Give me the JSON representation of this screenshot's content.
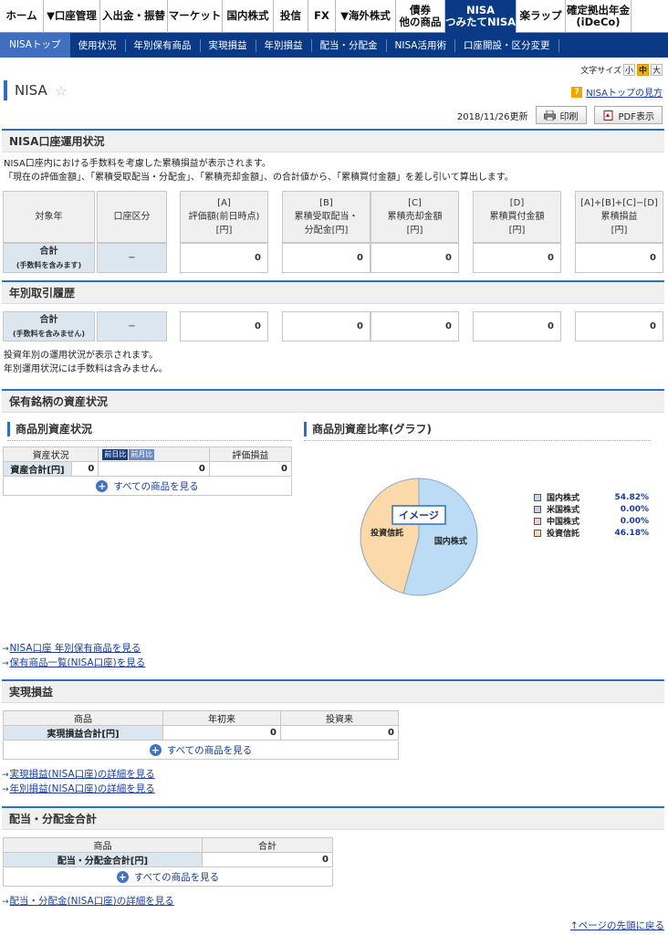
{
  "top_nav": [
    {
      "label": "ホーム",
      "name": "home",
      "w": 48
    },
    {
      "label": "▼口座管理",
      "name": "account",
      "w": 62
    },
    {
      "label": "入出金・振替",
      "name": "deposit",
      "w": 74
    },
    {
      "label": "マーケット",
      "name": "market",
      "w": 60
    },
    {
      "label": "国内株式",
      "name": "jp-stock",
      "w": 56
    },
    {
      "label": "投信",
      "name": "fund",
      "w": 38
    },
    {
      "label": "FX",
      "name": "fx",
      "w": 30
    },
    {
      "label": "▼海外株式",
      "name": "foreign-stock",
      "w": 66
    },
    {
      "label": "債券\n他の商品",
      "name": "bond",
      "w": 54
    },
    {
      "label": "NISA\nつみたてNISA",
      "name": "nisa",
      "w": 78,
      "active": true
    },
    {
      "label": "楽ラップ",
      "name": "rakuwrap",
      "w": 54
    },
    {
      "label": "確定拠出年金\n(iDeCo)",
      "name": "ideco",
      "w": 72
    }
  ],
  "sub_nav": [
    "NISAトップ",
    "使用状況",
    "年別保有商品",
    "実現損益",
    "年別損益",
    "配当・分配金",
    "NISA活用術",
    "口座開設・区分変更"
  ],
  "font_size": {
    "label": "文字サイズ",
    "small": "小",
    "medium": "中",
    "large": "大"
  },
  "page": {
    "title": "NISA",
    "howto": "NISAトップの見方",
    "updated": "2018/11/26更新",
    "print": "印刷",
    "pdf": "PDF表示"
  },
  "operation": {
    "title": "NISA口座運用状況",
    "note1": "NISA口座内における手数料を考慮した累積損益が表示されます。",
    "note2": "「現在の評価金額」、「累積受取配当・分配金」、「累積売却金額」、の合計値から、「累積買付金額」を差し引いて算出します。",
    "headers": [
      "対象年",
      "口座区分",
      "[A]\n評価額(前日時点)\n[円]",
      "[B]\n累積受取配当・\n分配金[円]",
      "[C]\n累積売却金額\n[円]",
      "[D]\n累積買付金額\n[円]",
      "[A]+[B]+[C]−[D]\n累積損益\n[円]"
    ],
    "total_label": "合計",
    "total_sub": "(手数料を含みます)",
    "dash": "−",
    "values": [
      "0",
      "0",
      "0",
      "0",
      "0"
    ]
  },
  "yearly": {
    "title": "年別取引履歴",
    "total_label": "合計",
    "total_sub": "(手数料を含みません)",
    "dash": "−",
    "values": [
      "0",
      "0",
      "0",
      "0",
      "0"
    ],
    "note1": "投資年別の運用状況が表示されます。",
    "note2": "年別運用状況には手数料は含みません。"
  },
  "holdings": {
    "title": "保有銘柄の資産状況",
    "product_title": "商品別資産状況",
    "graph_title": "商品別資産比率(グラフ)",
    "col_status": "資産状況",
    "toggle_prev_day": "前日比",
    "toggle_prev_month": "前月比",
    "col_eval": "評価損益",
    "row_label": "資産合計[円]",
    "row_values": [
      "0",
      "0",
      "0"
    ],
    "see_all": "すべての商品を見る",
    "link1": "NISA口座 年別保有商品を見る",
    "link2": "保有商品一覧(NISA口座)を見る"
  },
  "chart_data": {
    "type": "pie",
    "title": "商品別資産比率(グラフ)",
    "badge": "イメージ",
    "slices": [
      {
        "name": "国内株式",
        "value": 54.82,
        "label": "54.82%",
        "color": "#bcdcf5"
      },
      {
        "name": "米国株式",
        "value": 0.0,
        "label": "0.00%",
        "color": "#c9cfe9"
      },
      {
        "name": "中国株式",
        "value": 0.0,
        "label": "0.00%",
        "color": "#f6c9e0"
      },
      {
        "name": "投資信託",
        "value": 46.18,
        "label": "46.18%",
        "color": "#fbd9a8"
      }
    ]
  },
  "realized": {
    "title": "実現損益",
    "col_product": "商品",
    "col_ytd": "年初来",
    "col_since": "投資来",
    "row_label": "実現損益合計[円]",
    "values": [
      "0",
      "0"
    ],
    "see_all": "すべての商品を見る",
    "link1": "実現損益(NISA口座)の詳細を見る",
    "link2": "年別損益(NISA口座)の詳細を見る"
  },
  "dividend": {
    "title": "配当・分配金合計",
    "col_product": "商品",
    "col_total": "合計",
    "row_label": "配当・分配金合計[円]",
    "value": "0",
    "see_all": "すべての商品を見る",
    "link1": "配当・分配金(NISA口座)の詳細を見る"
  },
  "page_top": "↑ページの先頭に戻る"
}
